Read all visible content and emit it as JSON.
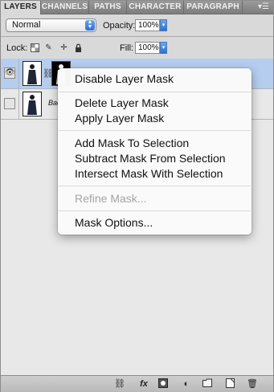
{
  "tabs": [
    {
      "label": "LAYERS",
      "active": true
    },
    {
      "label": "CHANNELS",
      "active": false
    },
    {
      "label": "PATHS",
      "active": false
    },
    {
      "label": "CHARACTER",
      "active": false
    },
    {
      "label": "PARAGRAPH",
      "active": false
    }
  ],
  "panel_menu_icon": "panel-menu-icon",
  "blend_mode": {
    "value": "Normal"
  },
  "opacity": {
    "label": "Opacity:",
    "value": "100%"
  },
  "lock": {
    "label": "Lock:",
    "icons": [
      "lock-transparent-icon",
      "lock-paint-icon",
      "lock-move-icon",
      "lock-all-icon"
    ]
  },
  "fill": {
    "label": "Fill:",
    "value": "100%"
  },
  "layers": [
    {
      "name": "",
      "visible": true,
      "selected": true,
      "has_mask": true
    },
    {
      "name": "Bac",
      "visible": false,
      "selected": false,
      "has_mask": false
    }
  ],
  "context_menu": {
    "items": [
      {
        "label": "Disable Layer Mask",
        "enabled": true
      },
      {
        "label": "Delete Layer Mask",
        "enabled": true
      },
      {
        "label": "Apply Layer Mask",
        "enabled": true
      },
      {
        "label": "Add Mask To Selection",
        "enabled": true
      },
      {
        "label": "Subtract Mask From Selection",
        "enabled": true
      },
      {
        "label": "Intersect Mask With Selection",
        "enabled": true
      },
      {
        "label": "Refine Mask...",
        "enabled": false
      },
      {
        "label": "Mask Options...",
        "enabled": true
      }
    ]
  },
  "bottom_bar": {
    "icons": [
      "link-layers-icon",
      "fx-icon",
      "add-mask-icon",
      "adjustment-layer-icon",
      "new-group-icon",
      "new-layer-icon",
      "trash-icon"
    ],
    "fx_label": "fx"
  },
  "colors": {
    "selected_row": "#b5cdef",
    "accent_blue": "#2c6fd1"
  }
}
